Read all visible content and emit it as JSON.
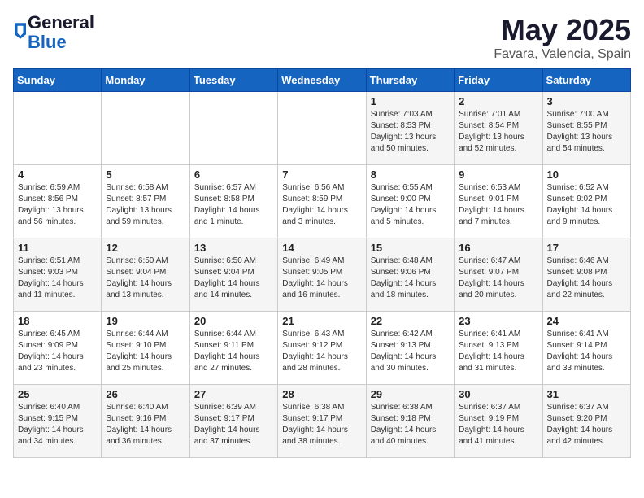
{
  "header": {
    "logo_general": "General",
    "logo_blue": "Blue",
    "month": "May 2025",
    "location": "Favara, Valencia, Spain"
  },
  "weekdays": [
    "Sunday",
    "Monday",
    "Tuesday",
    "Wednesday",
    "Thursday",
    "Friday",
    "Saturday"
  ],
  "weeks": [
    [
      {
        "day": "",
        "info": ""
      },
      {
        "day": "",
        "info": ""
      },
      {
        "day": "",
        "info": ""
      },
      {
        "day": "",
        "info": ""
      },
      {
        "day": "1",
        "info": "Sunrise: 7:03 AM\nSunset: 8:53 PM\nDaylight: 13 hours\nand 50 minutes."
      },
      {
        "day": "2",
        "info": "Sunrise: 7:01 AM\nSunset: 8:54 PM\nDaylight: 13 hours\nand 52 minutes."
      },
      {
        "day": "3",
        "info": "Sunrise: 7:00 AM\nSunset: 8:55 PM\nDaylight: 13 hours\nand 54 minutes."
      }
    ],
    [
      {
        "day": "4",
        "info": "Sunrise: 6:59 AM\nSunset: 8:56 PM\nDaylight: 13 hours\nand 56 minutes."
      },
      {
        "day": "5",
        "info": "Sunrise: 6:58 AM\nSunset: 8:57 PM\nDaylight: 13 hours\nand 59 minutes."
      },
      {
        "day": "6",
        "info": "Sunrise: 6:57 AM\nSunset: 8:58 PM\nDaylight: 14 hours\nand 1 minute."
      },
      {
        "day": "7",
        "info": "Sunrise: 6:56 AM\nSunset: 8:59 PM\nDaylight: 14 hours\nand 3 minutes."
      },
      {
        "day": "8",
        "info": "Sunrise: 6:55 AM\nSunset: 9:00 PM\nDaylight: 14 hours\nand 5 minutes."
      },
      {
        "day": "9",
        "info": "Sunrise: 6:53 AM\nSunset: 9:01 PM\nDaylight: 14 hours\nand 7 minutes."
      },
      {
        "day": "10",
        "info": "Sunrise: 6:52 AM\nSunset: 9:02 PM\nDaylight: 14 hours\nand 9 minutes."
      }
    ],
    [
      {
        "day": "11",
        "info": "Sunrise: 6:51 AM\nSunset: 9:03 PM\nDaylight: 14 hours\nand 11 minutes."
      },
      {
        "day": "12",
        "info": "Sunrise: 6:50 AM\nSunset: 9:04 PM\nDaylight: 14 hours\nand 13 minutes."
      },
      {
        "day": "13",
        "info": "Sunrise: 6:50 AM\nSunset: 9:04 PM\nDaylight: 14 hours\nand 14 minutes."
      },
      {
        "day": "14",
        "info": "Sunrise: 6:49 AM\nSunset: 9:05 PM\nDaylight: 14 hours\nand 16 minutes."
      },
      {
        "day": "15",
        "info": "Sunrise: 6:48 AM\nSunset: 9:06 PM\nDaylight: 14 hours\nand 18 minutes."
      },
      {
        "day": "16",
        "info": "Sunrise: 6:47 AM\nSunset: 9:07 PM\nDaylight: 14 hours\nand 20 minutes."
      },
      {
        "day": "17",
        "info": "Sunrise: 6:46 AM\nSunset: 9:08 PM\nDaylight: 14 hours\nand 22 minutes."
      }
    ],
    [
      {
        "day": "18",
        "info": "Sunrise: 6:45 AM\nSunset: 9:09 PM\nDaylight: 14 hours\nand 23 minutes."
      },
      {
        "day": "19",
        "info": "Sunrise: 6:44 AM\nSunset: 9:10 PM\nDaylight: 14 hours\nand 25 minutes."
      },
      {
        "day": "20",
        "info": "Sunrise: 6:44 AM\nSunset: 9:11 PM\nDaylight: 14 hours\nand 27 minutes."
      },
      {
        "day": "21",
        "info": "Sunrise: 6:43 AM\nSunset: 9:12 PM\nDaylight: 14 hours\nand 28 minutes."
      },
      {
        "day": "22",
        "info": "Sunrise: 6:42 AM\nSunset: 9:13 PM\nDaylight: 14 hours\nand 30 minutes."
      },
      {
        "day": "23",
        "info": "Sunrise: 6:41 AM\nSunset: 9:13 PM\nDaylight: 14 hours\nand 31 minutes."
      },
      {
        "day": "24",
        "info": "Sunrise: 6:41 AM\nSunset: 9:14 PM\nDaylight: 14 hours\nand 33 minutes."
      }
    ],
    [
      {
        "day": "25",
        "info": "Sunrise: 6:40 AM\nSunset: 9:15 PM\nDaylight: 14 hours\nand 34 minutes."
      },
      {
        "day": "26",
        "info": "Sunrise: 6:40 AM\nSunset: 9:16 PM\nDaylight: 14 hours\nand 36 minutes."
      },
      {
        "day": "27",
        "info": "Sunrise: 6:39 AM\nSunset: 9:17 PM\nDaylight: 14 hours\nand 37 minutes."
      },
      {
        "day": "28",
        "info": "Sunrise: 6:38 AM\nSunset: 9:17 PM\nDaylight: 14 hours\nand 38 minutes."
      },
      {
        "day": "29",
        "info": "Sunrise: 6:38 AM\nSunset: 9:18 PM\nDaylight: 14 hours\nand 40 minutes."
      },
      {
        "day": "30",
        "info": "Sunrise: 6:37 AM\nSunset: 9:19 PM\nDaylight: 14 hours\nand 41 minutes."
      },
      {
        "day": "31",
        "info": "Sunrise: 6:37 AM\nSunset: 9:20 PM\nDaylight: 14 hours\nand 42 minutes."
      }
    ]
  ]
}
